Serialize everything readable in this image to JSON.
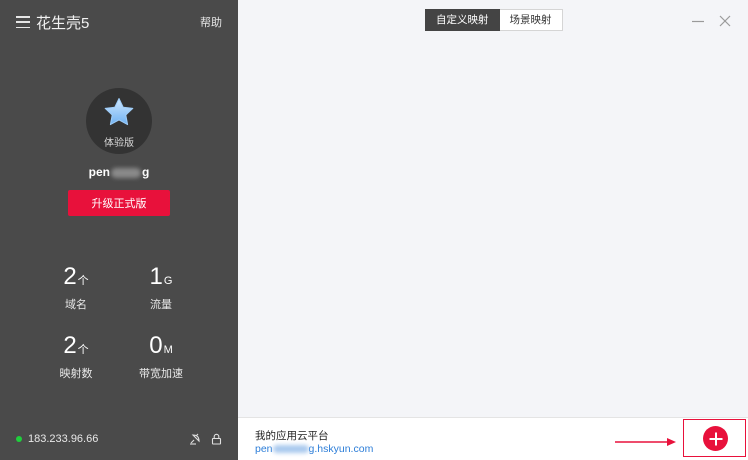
{
  "app": {
    "title": "花生壳5",
    "help_label": "帮助"
  },
  "profile": {
    "edition": "体验版",
    "username_start": "pen",
    "username_end": "g",
    "upgrade_label": "升级正式版"
  },
  "stats": [
    {
      "value": "2",
      "unit": "个",
      "label": "域名"
    },
    {
      "value": "1",
      "unit": "G",
      "label": "流量"
    },
    {
      "value": "2",
      "unit": "个",
      "label": "映射数"
    },
    {
      "value": "0",
      "unit": "M",
      "label": "带宽加速"
    }
  ],
  "status": {
    "ip": "183.233.96.66",
    "online_color": "#1fcf3c"
  },
  "tabs": [
    {
      "label": "自定义映射",
      "active": true
    },
    {
      "label": "场景映射",
      "active": false
    }
  ],
  "cloud": {
    "title": "我的应用云平台",
    "link_start": "pen",
    "link_end": "g.hskyun.com"
  },
  "colors": {
    "accent": "#e8113b",
    "sidebar": "#4a4a4a",
    "link": "#2d7ed8"
  }
}
